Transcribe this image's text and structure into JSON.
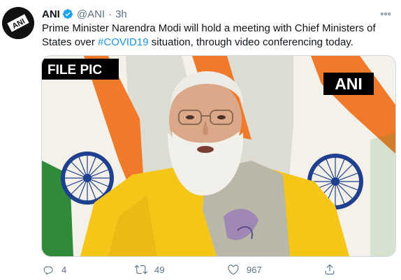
{
  "tweet": {
    "author_name": "ANI",
    "handle": "@ANI",
    "separator": "·",
    "time": "3h",
    "avatar_text": "ANI",
    "text_before": "Prime Minister Narendra Modi will hold a meeting with Chief Ministers of States over ",
    "hashtag": "#COVID19",
    "text_after": " situation, through video conferencing today.",
    "media": {
      "badge_left": "FILE PIC",
      "badge_right": "ANI"
    }
  },
  "actions": {
    "reply_count": "4",
    "retweet_count": "49",
    "like_count": "967"
  },
  "colors": {
    "accent": "#1b95e0",
    "muted": "#5b7083",
    "saffron": "#f07a2a",
    "green": "#2f8a3a",
    "chakra": "#1f3f8f",
    "kurta": "#f5c518"
  },
  "icons": [
    "verified-icon",
    "more-icon",
    "reply-icon",
    "retweet-icon",
    "like-icon",
    "share-icon"
  ]
}
